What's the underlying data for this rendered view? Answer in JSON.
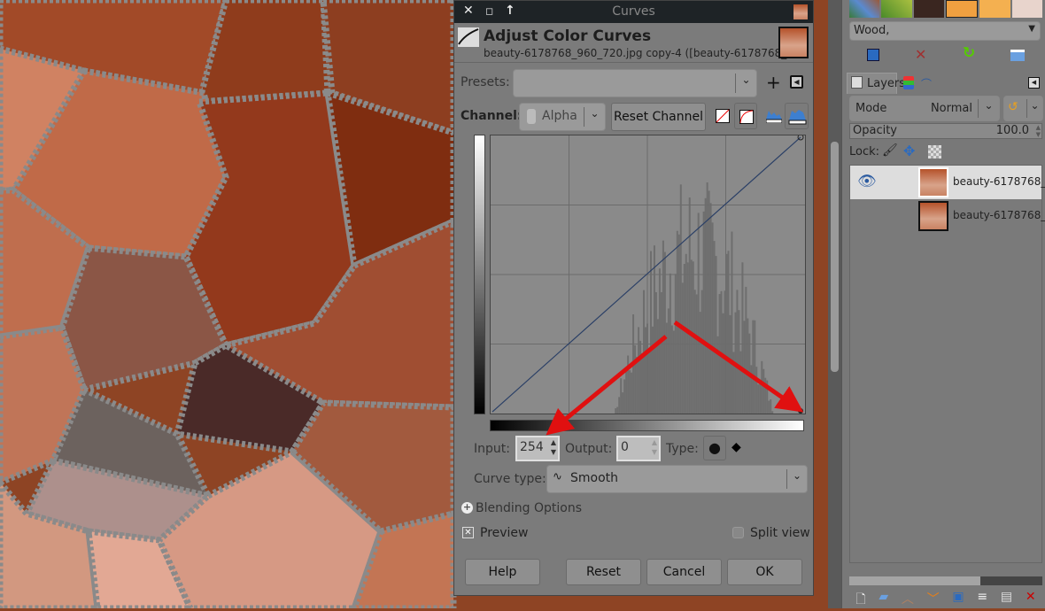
{
  "dialog": {
    "window_title": "Curves",
    "header_title": "Adjust Color Curves",
    "header_subtitle": "beauty-6178768_960_720.jpg copy-4 ([beauty-6178768_...",
    "presets_label": "Presets:",
    "presets_value": "",
    "channel_label": "Channel:",
    "channel_value": "Alpha",
    "reset_channel": "Reset Channel",
    "input_label": "Input:",
    "input_value": "254",
    "output_label": "Output:",
    "output_value": "0",
    "type_label": "Type:",
    "curve_type_label": "Curve type:",
    "curve_type_value": "Smooth",
    "blending_options": "Blending Options",
    "preview": "Preview",
    "preview_checked": true,
    "split_view": "Split view",
    "split_view_checked": false,
    "buttons": {
      "help": "Help",
      "reset": "Reset",
      "cancel": "Cancel",
      "ok": "OK"
    }
  },
  "panel": {
    "pattern_name": "Wood,",
    "tabs": [
      "Layers"
    ],
    "mode_label": "Mode",
    "mode_value": "Normal",
    "opacity_label": "Opacity",
    "opacity_value": "100.0",
    "lock_label": "Lock:",
    "layers": [
      {
        "name": "beauty-6178768_9",
        "visible": true,
        "selected": true
      },
      {
        "name": "beauty-6178768_9",
        "visible": false,
        "selected": false
      }
    ]
  },
  "colors": {
    "arrow": "#e01010",
    "curve": "#2a3f66",
    "titlebar": "#1e2326"
  }
}
